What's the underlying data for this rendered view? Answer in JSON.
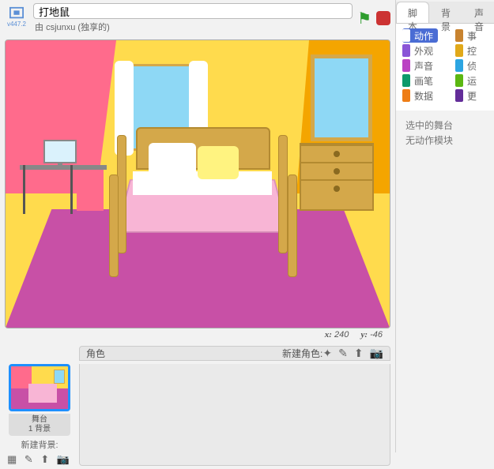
{
  "header": {
    "version": "v447.2",
    "title": "打地鼠",
    "byline_prefix": "由 ",
    "author": "csjunxu",
    "byline_suffix": " (独享的)"
  },
  "stage": {
    "coords": {
      "x_label": "x:",
      "x": "240",
      "y_label": "y:",
      "y": "-46"
    }
  },
  "sprite_bar": {
    "label": "角色",
    "new_label": "新建角色:"
  },
  "stage_thumb": {
    "name": "舞台",
    "backdrops": "1 背景",
    "new_label": "新建背景:"
  },
  "tabs": {
    "scripts": "脚本",
    "backdrops": "背景",
    "sounds": "声音"
  },
  "categories": {
    "left": [
      {
        "name": "动作",
        "color": "#4a6cd4",
        "selected": true
      },
      {
        "name": "外观",
        "color": "#8a55d7"
      },
      {
        "name": "声音",
        "color": "#bb42c3"
      },
      {
        "name": "画笔",
        "color": "#0e9a6c"
      },
      {
        "name": "数据",
        "color": "#ee7d16"
      }
    ],
    "right": [
      {
        "name": "事",
        "color": "#c88330"
      },
      {
        "name": "控",
        "color": "#e1a91a"
      },
      {
        "name": "侦",
        "color": "#2ca5e2"
      },
      {
        "name": "运",
        "color": "#5cb712"
      },
      {
        "name": "更",
        "color": "#632d99"
      }
    ]
  },
  "blocks_msg": {
    "line1": "选中的舞台",
    "line2": "无动作模块"
  }
}
